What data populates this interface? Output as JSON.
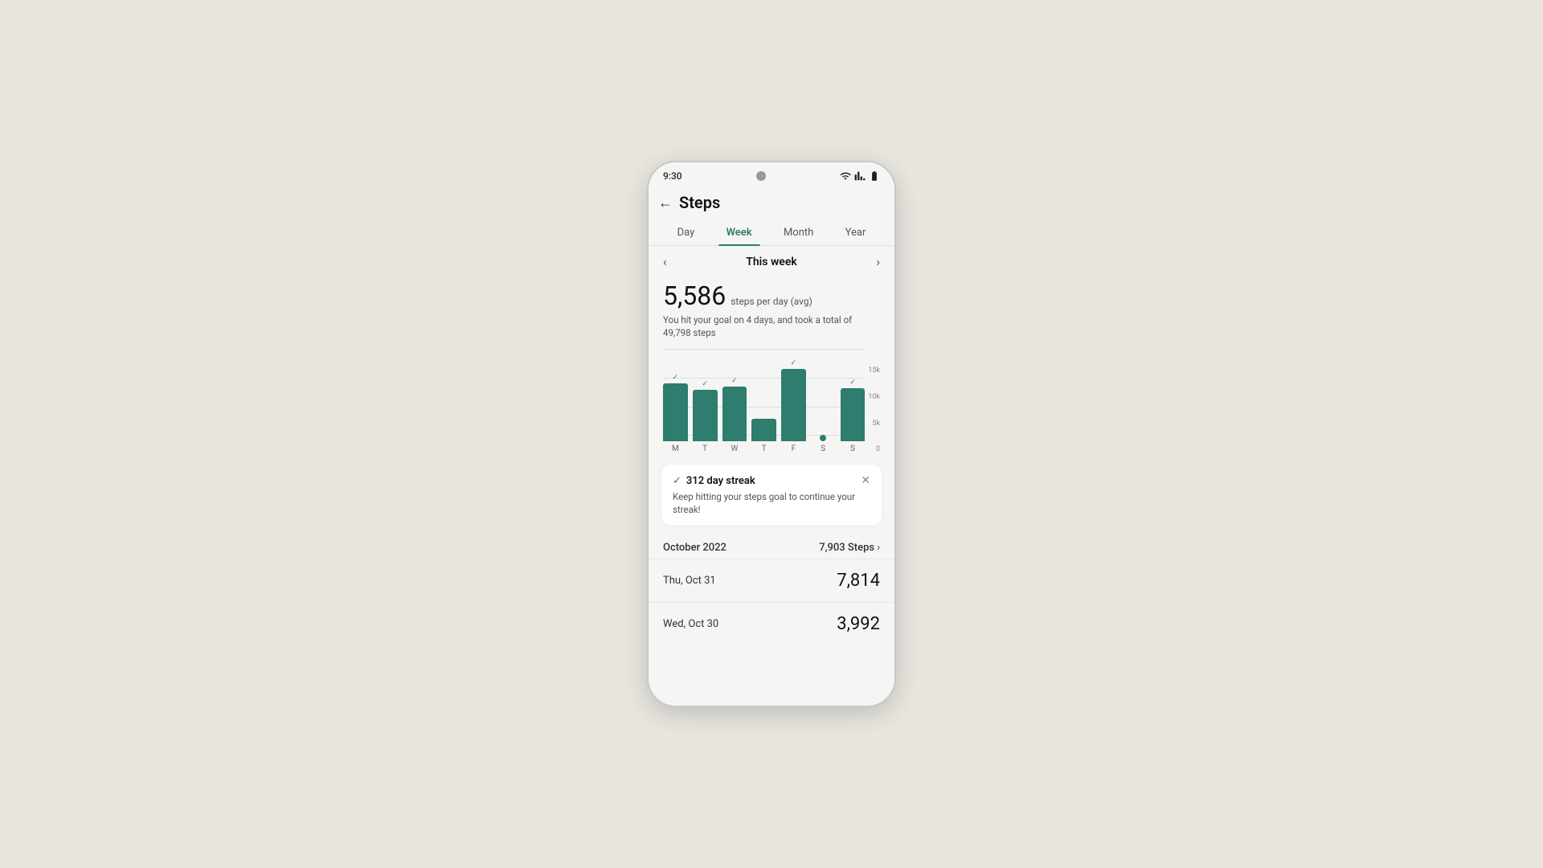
{
  "statusBar": {
    "time": "9:30",
    "icons": [
      "wifi",
      "signal",
      "battery"
    ]
  },
  "header": {
    "backLabel": "←",
    "title": "Steps"
  },
  "tabs": [
    {
      "label": "Day",
      "active": false
    },
    {
      "label": "Week",
      "active": true
    },
    {
      "label": "Month",
      "active": false
    },
    {
      "label": "Year",
      "active": false
    }
  ],
  "weekNav": {
    "prevArrow": "‹",
    "nextArrow": "›",
    "label": "This week"
  },
  "stats": {
    "stepsAvg": "5,586",
    "stepsUnit": "steps per day (avg)",
    "description": "You hit your goal on 4 days, and took a total of 49,798 steps"
  },
  "chart": {
    "yLabels": [
      "15k",
      "10k",
      "5k",
      "0"
    ],
    "bars": [
      {
        "day": "M",
        "heightPct": 72,
        "hasCheck": true,
        "isDot": false
      },
      {
        "day": "T",
        "heightPct": 65,
        "hasCheck": true,
        "isDot": false
      },
      {
        "day": "W",
        "heightPct": 70,
        "hasCheck": true,
        "isDot": false
      },
      {
        "day": "T",
        "heightPct": 30,
        "hasCheck": false,
        "isDot": false
      },
      {
        "day": "F",
        "heightPct": 90,
        "hasCheck": true,
        "isDot": false
      },
      {
        "day": "S",
        "heightPct": 2,
        "hasCheck": false,
        "isDot": true
      },
      {
        "day": "S",
        "heightPct": 68,
        "hasCheck": true,
        "isDot": false
      }
    ]
  },
  "streakCard": {
    "checkIcon": "✓",
    "title": "312 day streak",
    "closeIcon": "✕",
    "description": "Keep hitting your steps goal to continue your streak!"
  },
  "monthSection": {
    "monthLabel": "October 2022",
    "monthSteps": "7,903 Steps",
    "arrowIcon": "›"
  },
  "dayRows": [
    {
      "date": "Thu, Oct 31",
      "steps": "7,814"
    },
    {
      "date": "Wed, Oct 30",
      "steps": "3,992"
    }
  ]
}
